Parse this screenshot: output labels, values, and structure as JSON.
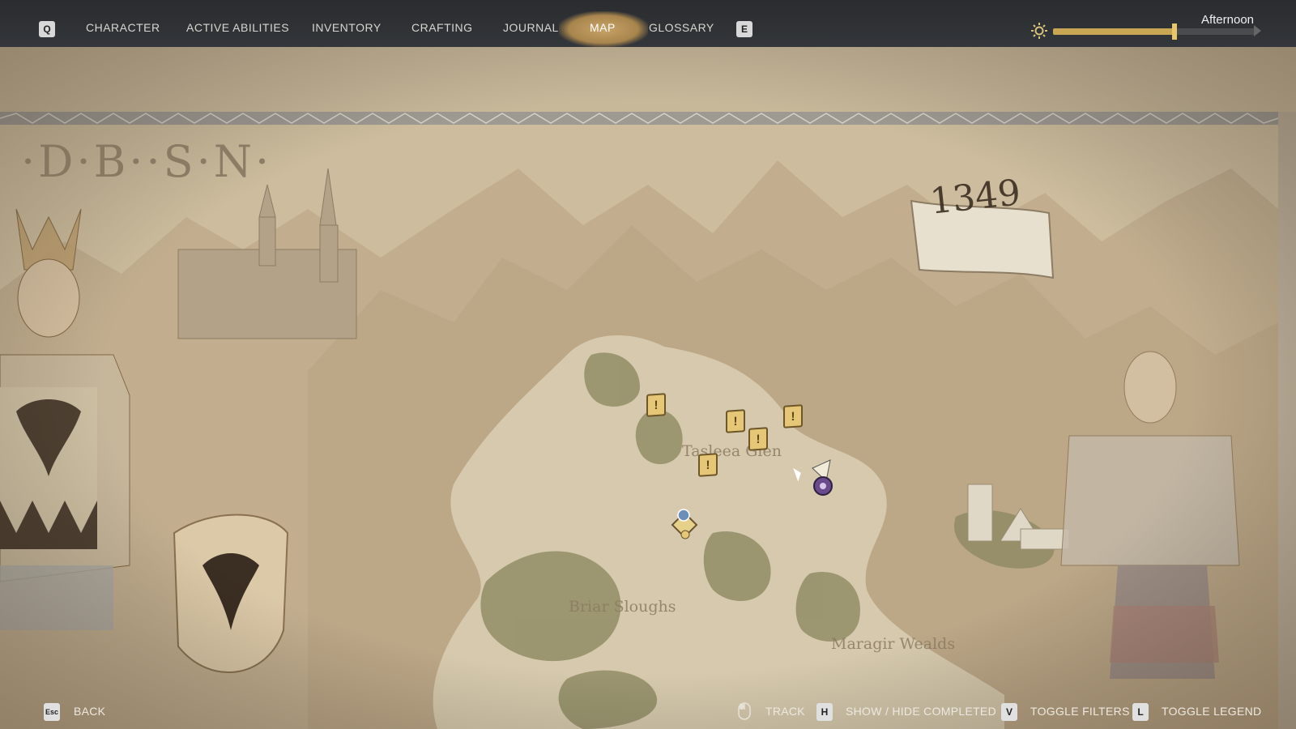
{
  "top_nav": {
    "left_key": "Q",
    "right_key": "E",
    "tabs": [
      "CHARACTER",
      "ACTIVE ABILITIES",
      "INVENTORY",
      "CRAFTING",
      "JOURNAL",
      "MAP",
      "GLOSSARY"
    ],
    "active_tab": "MAP"
  },
  "time_of_day": {
    "label": "Afternoon",
    "progress": 0.6,
    "icon": "sun-icon"
  },
  "map": {
    "corner_letters": "·D·B··S·N·",
    "year_banner": "1349",
    "regions": [
      "Tasleea Glen",
      "Briar Sloughs",
      "Maragir Wealds"
    ],
    "quest_marker_symbol": "!",
    "colors": {
      "parchment": "#c9b89a",
      "quest_marker": "#e6c777",
      "player_marker": "#6a4a8a"
    }
  },
  "bottom_hints": {
    "back": {
      "key": "Esc",
      "label": "BACK"
    },
    "track": {
      "icon": "mouse-icon",
      "label": "TRACK"
    },
    "show_hide": {
      "key": "H",
      "label": "SHOW / HIDE COMPLETED"
    },
    "filters": {
      "key": "V",
      "label": "TOGGLE FILTERS"
    },
    "legend": {
      "key": "L",
      "label": "TOGGLE LEGEND"
    }
  }
}
